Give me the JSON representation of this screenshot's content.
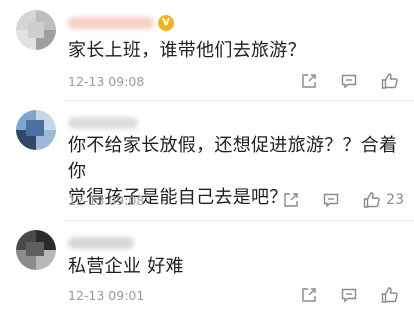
{
  "comments": [
    {
      "text_lines": [
        "家长上班，谁带他们去旅游？"
      ],
      "time": "12-13 09:08",
      "likes": "",
      "icons": [
        "share-icon",
        "comment-icon",
        "thumbs-up-icon"
      ],
      "avatar_colors": [
        "#c9c9c9",
        "#d7d7d7",
        "#b8b8b8",
        "#e6e6e6",
        "#9c9c9c",
        "#d0d0d0"
      ],
      "name_blur_color": "#f4d0c5"
    },
    {
      "text_lines": [
        "你不给家长放假，还想促进旅游？？合着你",
        "觉得孩子是能自己去是吧？"
      ],
      "time": "12-13 09:08",
      "likes": "23",
      "icons": [
        "share-icon",
        "comment-icon",
        "thumbs-up-icon"
      ],
      "avatar_colors": [
        "#3c5c8c",
        "#7aa3cf",
        "#b9cde6",
        "#2b3a55",
        "#93b2d6",
        "#dbe5f1"
      ],
      "name_blur_color": "#dcdcdc"
    },
    {
      "text_lines": [
        "私营企业 好难"
      ],
      "time": "12-13 09:01",
      "likes": "",
      "icons": [
        "share-icon",
        "comment-icon",
        "thumbs-up-icon"
      ],
      "avatar_colors": [
        "#2a2a2a",
        "#5c5c5c",
        "#8f8f8f",
        "#3b3b3b",
        "#b5b5b5",
        "#707070"
      ],
      "name_blur_color": "#d8d8d8"
    }
  ]
}
